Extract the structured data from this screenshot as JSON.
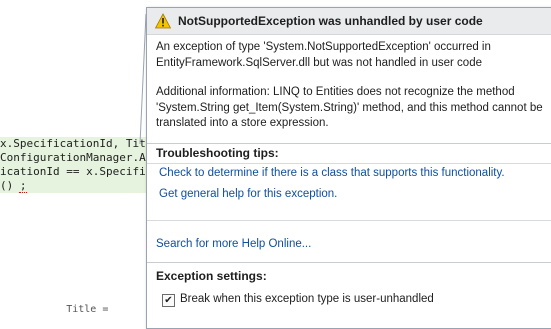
{
  "editor": {
    "lines": [
      "x.SpecificationId, Titl",
      "ConfigurationManager.Ap",
      "icationId == x.Specific",
      "() ;"
    ],
    "bottom_fragment": "           Title ="
  },
  "exception_popup": {
    "title": "NotSupportedException was unhandled by user code",
    "message_line1": "An exception of type 'System.NotSupportedException' occurred in",
    "message_line2": "EntityFramework.SqlServer.dll but was not handled in user code",
    "additional_line1": "Additional information: LINQ to Entities does not recognize the method",
    "additional_line2": "'System.String get_Item(System.String)' method, and this method cannot be",
    "additional_line3": "translated into a store expression.",
    "troubleshooting_title": "Troubleshooting tips:",
    "tips": [
      "Check to determine if there is a class that supports this functionality.",
      "Get general help for this exception."
    ],
    "search_link": "Search for more Help Online...",
    "exception_settings_title": "Exception settings:",
    "break_checkbox_label": "Break when this exception type is user-unhandled",
    "break_checkbox_checked": true,
    "warning_icon": "warning-triangle-icon",
    "accent_colors": {
      "link": "#0e4f9f",
      "code_highlight": "#e6f3df",
      "header_bg": "#e9ebed"
    }
  }
}
